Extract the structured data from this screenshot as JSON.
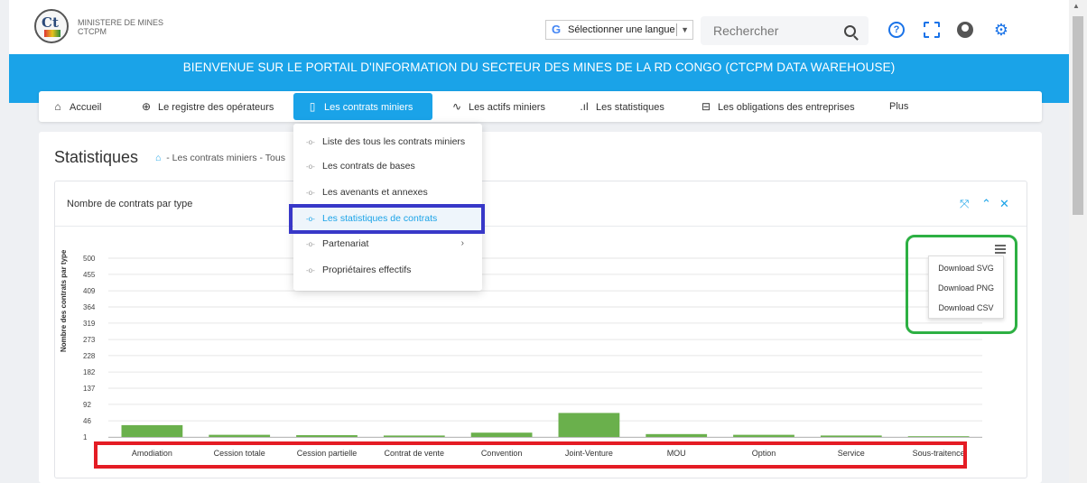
{
  "header": {
    "logo_text": "Ct",
    "org_line1": "MINISTERE DE MINES",
    "org_line2": "CTCPM",
    "language_select": "Sélectionner une langue",
    "language_icon": "G",
    "search_placeholder": "Rechercher",
    "icons": [
      "search-icon",
      "help-icon",
      "fullscreen-icon",
      "user-icon",
      "settings-icon"
    ]
  },
  "banner": {
    "title": "BIENVENUE SUR LE PORTAIL D'INFORMATION DU SECTEUR DES MINES DE LA RD CONGO (CTCPM DATA WAREHOUSE)"
  },
  "nav": {
    "items": [
      {
        "label": "Accueil",
        "icon": "home-icon"
      },
      {
        "label": "Le registre des opérateurs",
        "icon": "globe-icon"
      },
      {
        "label": "Les contrats miniers",
        "icon": "document-icon",
        "active": true
      },
      {
        "label": "Les actifs miniers",
        "icon": "activity-icon"
      },
      {
        "label": "Les statistiques",
        "icon": "bar-chart-icon"
      },
      {
        "label": "Les obligations des entreprises",
        "icon": "table-icon"
      },
      {
        "label": "Plus",
        "icon": ""
      }
    ]
  },
  "dropdown": {
    "items": [
      {
        "label": "Liste des tous les contrats miniers"
      },
      {
        "label": "Les contrats de bases"
      },
      {
        "label": "Les avenants et annexes"
      },
      {
        "label": "Les statistiques de contrats",
        "active": true
      },
      {
        "label": "Partenariat",
        "has_submenu": true
      },
      {
        "label": "Propriétaires effectifs"
      }
    ],
    "chevron": "›"
  },
  "page": {
    "title": "Statistiques",
    "breadcrumb": "- Les contrats miniers  -  Tous"
  },
  "chart_card": {
    "title": "Nombre de contrats par type",
    "controls": [
      "✕̸",
      "^",
      "×"
    ]
  },
  "export_menu": {
    "items": [
      "Download SVG",
      "Download PNG",
      "Download CSV"
    ]
  },
  "colors": {
    "accent": "#1aa3e8",
    "bar": "#6ab04c",
    "highlight_green": "#2db043",
    "highlight_red": "#e41c24",
    "highlight_blue": "#3838c8"
  },
  "chart_data": {
    "type": "bar",
    "title": "",
    "ylabel": "Nombre des contrats par type",
    "xlabel": "",
    "yticks": [
      1,
      46,
      92,
      137,
      182,
      228,
      273,
      319,
      364,
      409,
      455,
      500
    ],
    "ylim": [
      1,
      500
    ],
    "grid": true,
    "categories": [
      "Amodiation",
      "Cession totale",
      "Cession partielle",
      "Contrat de vente",
      "Convention",
      "Joint-Venture",
      "MOU",
      "Option",
      "Service",
      "Sous-traitence"
    ],
    "values": [
      34,
      7,
      6,
      5,
      13,
      68,
      9,
      7,
      5,
      3
    ]
  }
}
